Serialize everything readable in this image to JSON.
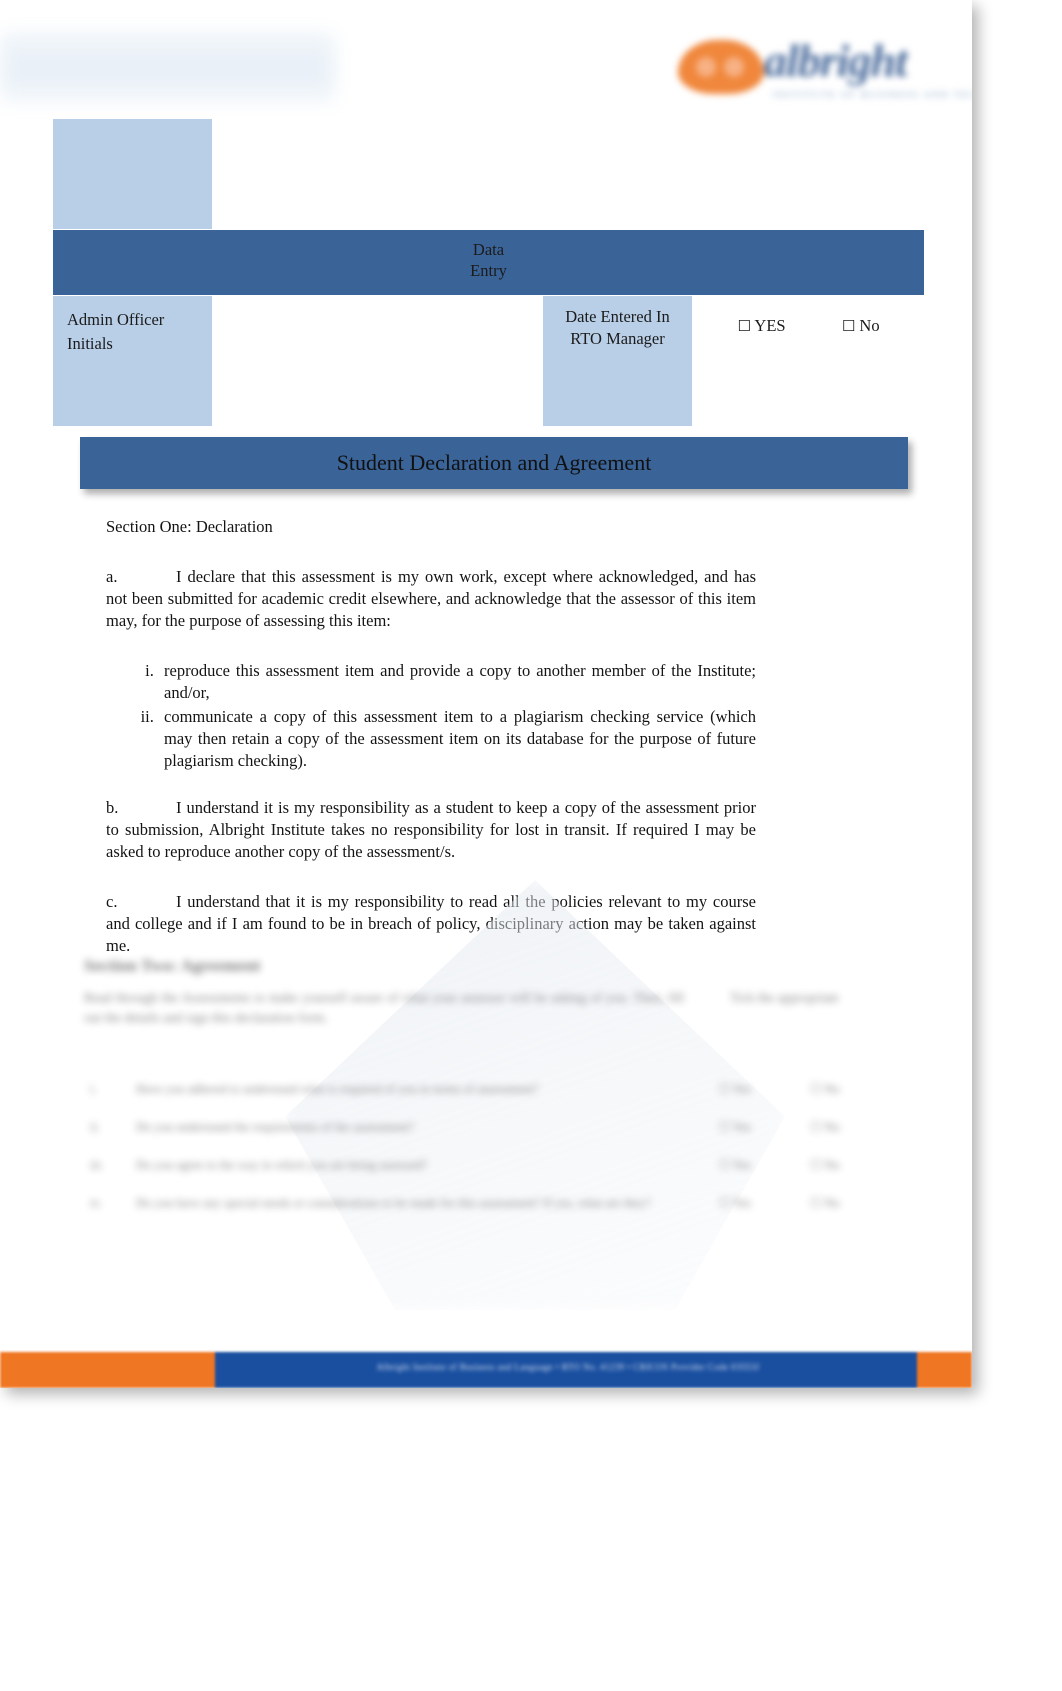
{
  "header": {
    "logo_word": "albright",
    "logo_tagline": "INSTITUTE OF BUSINESS AND TECHNOLOGY"
  },
  "info_table": {
    "banner_label": "Data\nEntry",
    "admin_officer_label": "Admin\n\nOfficer\nInitials",
    "date_entered_label": "Date\nEntered In\nRTO\nManager",
    "yes_label": "YES",
    "no_label": "No",
    "checkbox_glyph": "☐"
  },
  "title_banner": {
    "title": "Student Declaration and Agreement"
  },
  "section_one": {
    "heading": "Section One: Declaration",
    "item_a_label": "a.",
    "item_a_text": "I declare that this assessment is my own work, except where acknowledged, and has not been submitted for academic credit elsewhere, and acknowledge that the assessor of this item may, for the purpose of assessing this item:",
    "sub_items": [
      "reproduce this assessment item and provide a copy to another member of the Institute; and/or,",
      "communicate a copy of this assessment item to a plagiarism checking service (which may   then retain a copy of the assessment item on its database for the purpose of future plagiarism    checking)."
    ],
    "item_b_label": "b.",
    "item_b_text": "I understand it is my responsibility as a student to keep a copy of the assessment prior to submission, Albright Institute takes no responsibility for lost in transit. If required I may be asked to reproduce another copy of the assessment/s.",
    "item_c_label": "c.",
    "item_c_text": "I understand that it is my responsibility to read all the policies relevant to my course and   college and if     I am found to be in breach of policy, disciplinary action may be taken against me."
  },
  "section_two": {
    "heading": "Section Two: Agreement",
    "intro": "Read through the Assessments to make yourself aware of what your assessor will be asking of you. Then, fill out the details and sign this declaration form.",
    "column_header": "Tick the appropriate",
    "questions": [
      {
        "num": "i.",
        "text": "Have you adhered to understand what is required of you in terms of assessment?",
        "yes": "Yes",
        "no": "No"
      },
      {
        "num": "ii.",
        "text": "Do you understand the requirements of the assessment?",
        "yes": "Yes",
        "no": "No"
      },
      {
        "num": "iii.",
        "text": "Do you agree to the way in which you are being assessed?",
        "yes": "Yes",
        "no": "No"
      },
      {
        "num": "iv.",
        "text": "Do you have any special needs or considerations to be made for this assessment? If yes, what are they?",
        "yes": "Yes",
        "no": "No"
      }
    ]
  },
  "footer": {
    "text": "Albright Institute of Business and Language • RTO No. 41239 • CRICOS Provider Code 03553J"
  },
  "colors": {
    "banner_blue": "#3a6398",
    "cell_light_blue": "#b9cfe8",
    "logo_orange": "#f0873c",
    "logo_blue": "#4a6b9c",
    "footer_orange": "#ef7622",
    "footer_blue": "#1a4fa0"
  }
}
